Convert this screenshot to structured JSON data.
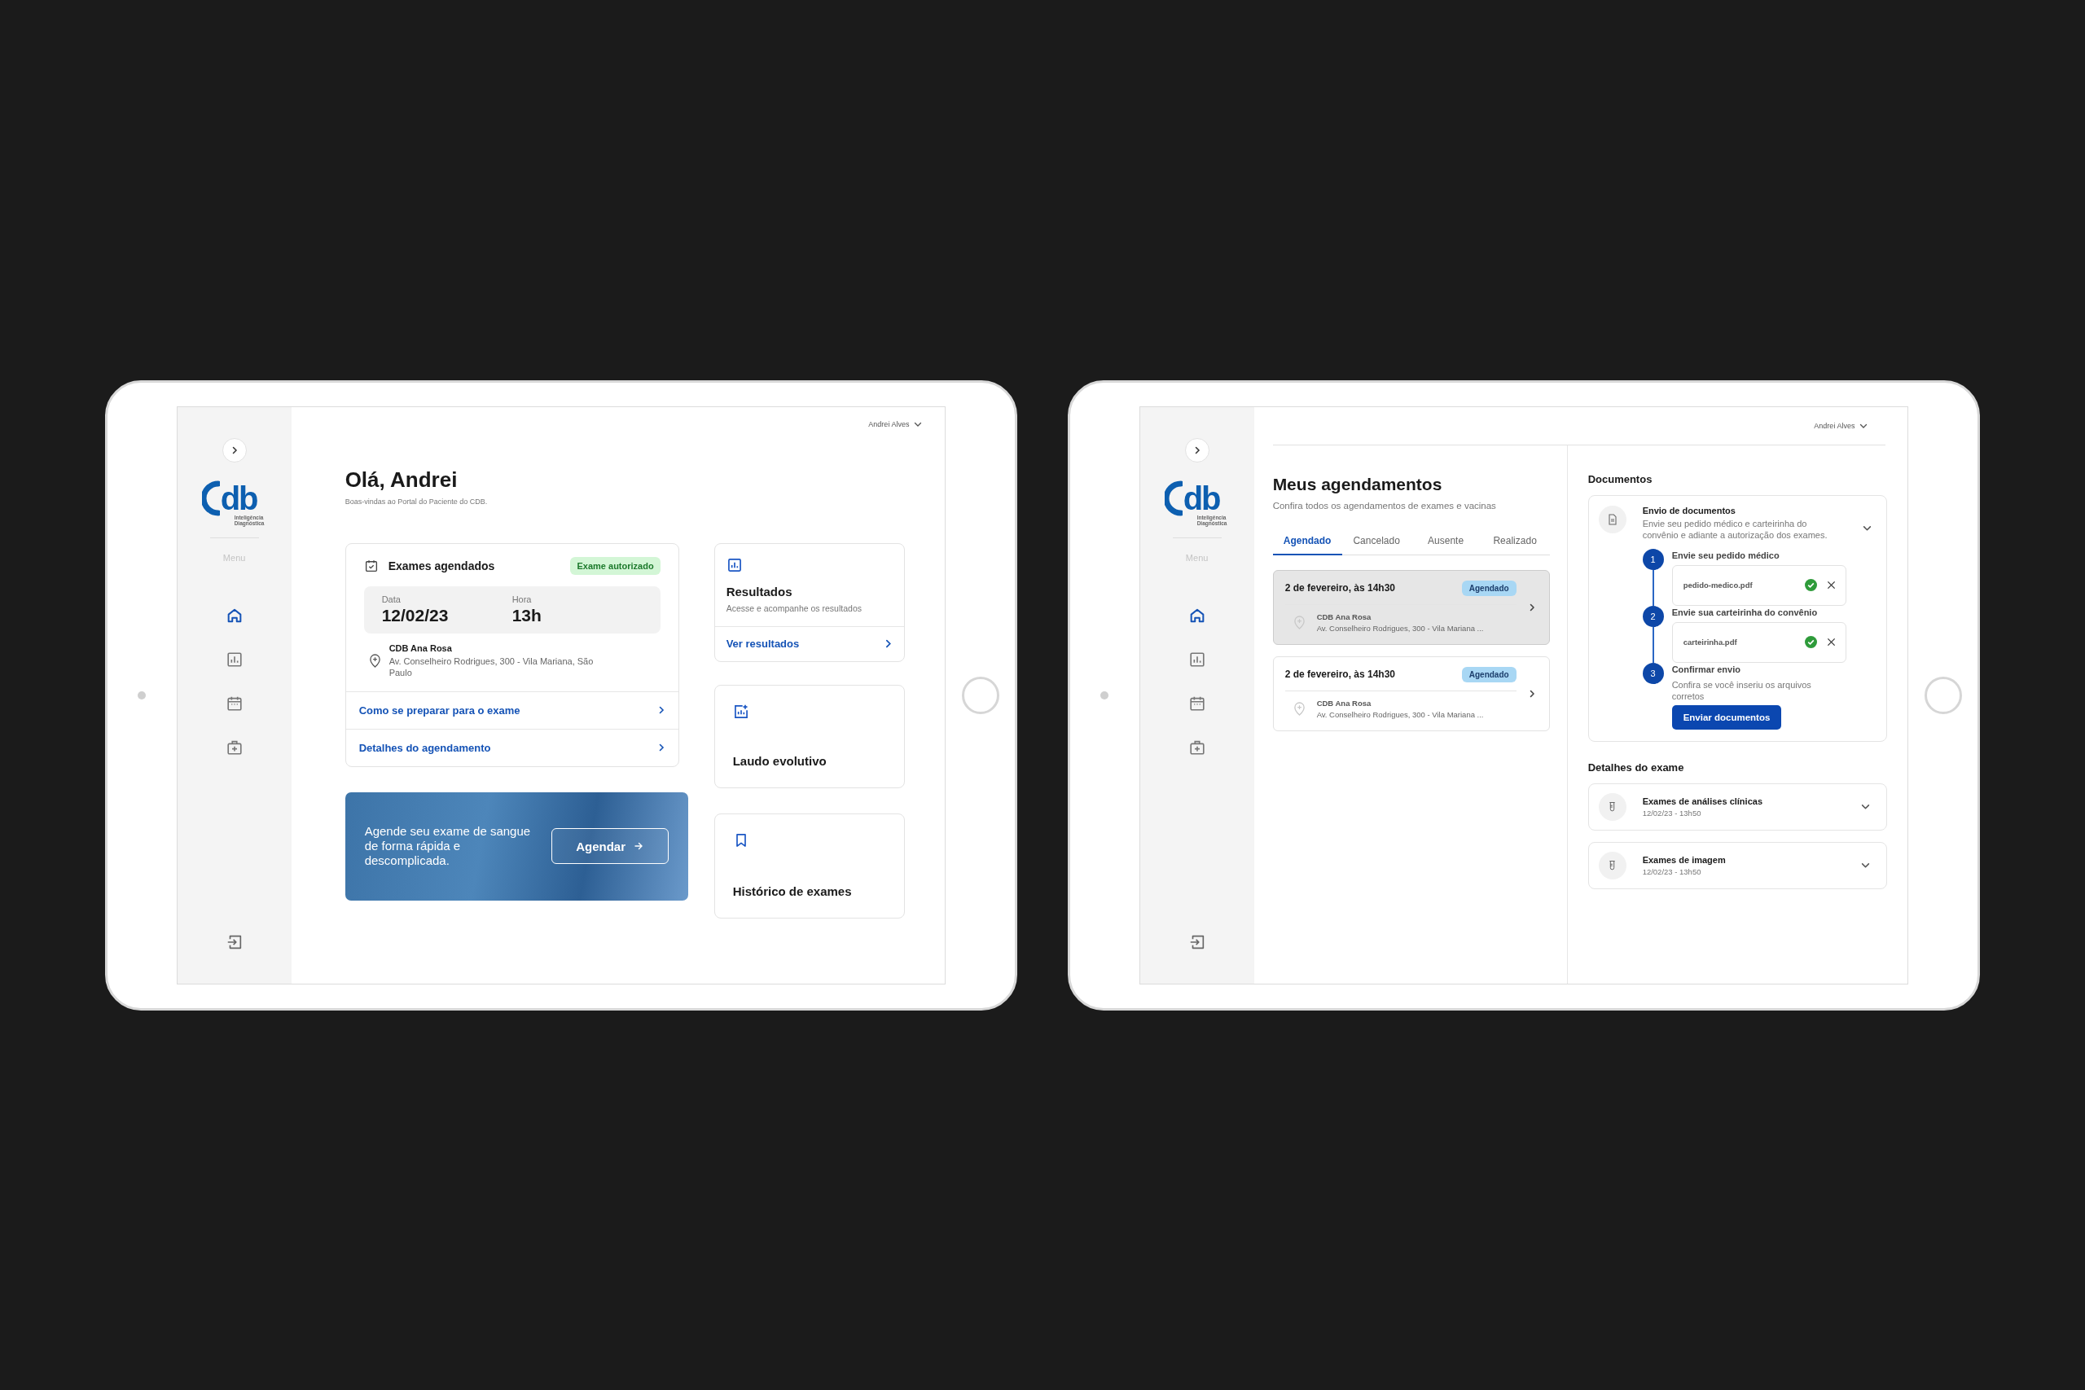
{
  "tablets": [
    {
      "kind": "dashboard",
      "user": "Andrei Alves",
      "logo": {
        "mark": "db",
        "tagline": "Inteligência Diagnóstica"
      },
      "menu_label": "Menu",
      "nav": [
        {
          "selected": true
        },
        {
          "selected": false
        },
        {
          "selected": false
        },
        {
          "selected": false
        }
      ],
      "greeting": "Olá, Andrei",
      "welcome": "Boas-vindas ao Portal do Paciente do CDB.",
      "exam_card": {
        "title": "Exames agendados",
        "badge": "Exame autorizado",
        "date_label": "Data",
        "date": "12/02/23",
        "time_label": "Hora",
        "time": "13h",
        "place": "CDB Ana Rosa",
        "address": "Av. Conselheiro Rodrigues, 300 - Vila Mariana, São Paulo",
        "links": [
          "Como se preparar para o exame",
          "Detalhes do agendamento"
        ]
      },
      "results_card": {
        "title": "Resultados",
        "description": "Acesse e acompanhe os resultados",
        "link": "Ver resultados"
      },
      "tiles": [
        "Laudo evolutivo",
        "Histórico de exames"
      ],
      "banner": {
        "text": "Agende seu exame de sangue de forma rápida e descomplicada.",
        "button": "Agendar"
      }
    },
    {
      "kind": "appointments",
      "user": "Andrei Alves",
      "logo": {
        "mark": "db",
        "tagline": "Inteligência Diagnóstica"
      },
      "menu_label": "Menu",
      "nav": [
        {
          "selected": true
        },
        {
          "selected": false
        },
        {
          "selected": false
        },
        {
          "selected": false
        }
      ],
      "title": "Meus agendamentos",
      "subtitle": "Confira todos os agendamentos de exames e vacinas",
      "tabs": [
        {
          "label": "Agendado",
          "selected": true
        },
        {
          "label": "Cancelado",
          "selected": false
        },
        {
          "label": "Ausente",
          "selected": false
        },
        {
          "label": "Realizado",
          "selected": false
        }
      ],
      "appointments": [
        {
          "when": "2 de fevereiro, às 14h30",
          "status": "Agendado",
          "place": "CDB Ana Rosa",
          "address": "Av. Conselheiro Rodrigues, 300 - Vila Mariana ...",
          "selected": true
        },
        {
          "when": "2 de fevereiro, às 14h30",
          "status": "Agendado",
          "place": "CDB Ana Rosa",
          "address": "Av. Conselheiro Rodrigues, 300 - Vila Mariana ...",
          "selected": false
        }
      ],
      "documents": {
        "heading": "Documentos",
        "title": "Envio de documentos",
        "description": "Envie seu pedido médico e carteirinha do convênio e adiante a autorização dos exames.",
        "steps": [
          {
            "kind": "upload",
            "number": "1",
            "title": "Envie seu pedido médico",
            "file": "pedido-medico.pdf",
            "verified": true
          },
          {
            "kind": "upload",
            "number": "2",
            "title": "Envie sua carteirinha do convênio",
            "file": "carteirinha.pdf",
            "verified": true
          },
          {
            "kind": "confirm",
            "number": "3",
            "title": "Confirmar envio",
            "description": "Confira se você inseriu os arquivos corretos",
            "button": "Enviar documentos"
          }
        ]
      },
      "exam_details": {
        "heading": "Detalhes do exame",
        "items": [
          {
            "title": "Exames de análises clínicas",
            "time": "12/02/23 - 13h50"
          },
          {
            "title": "Exames de imagem",
            "time": "12/02/23 - 13h50"
          }
        ]
      }
    }
  ]
}
